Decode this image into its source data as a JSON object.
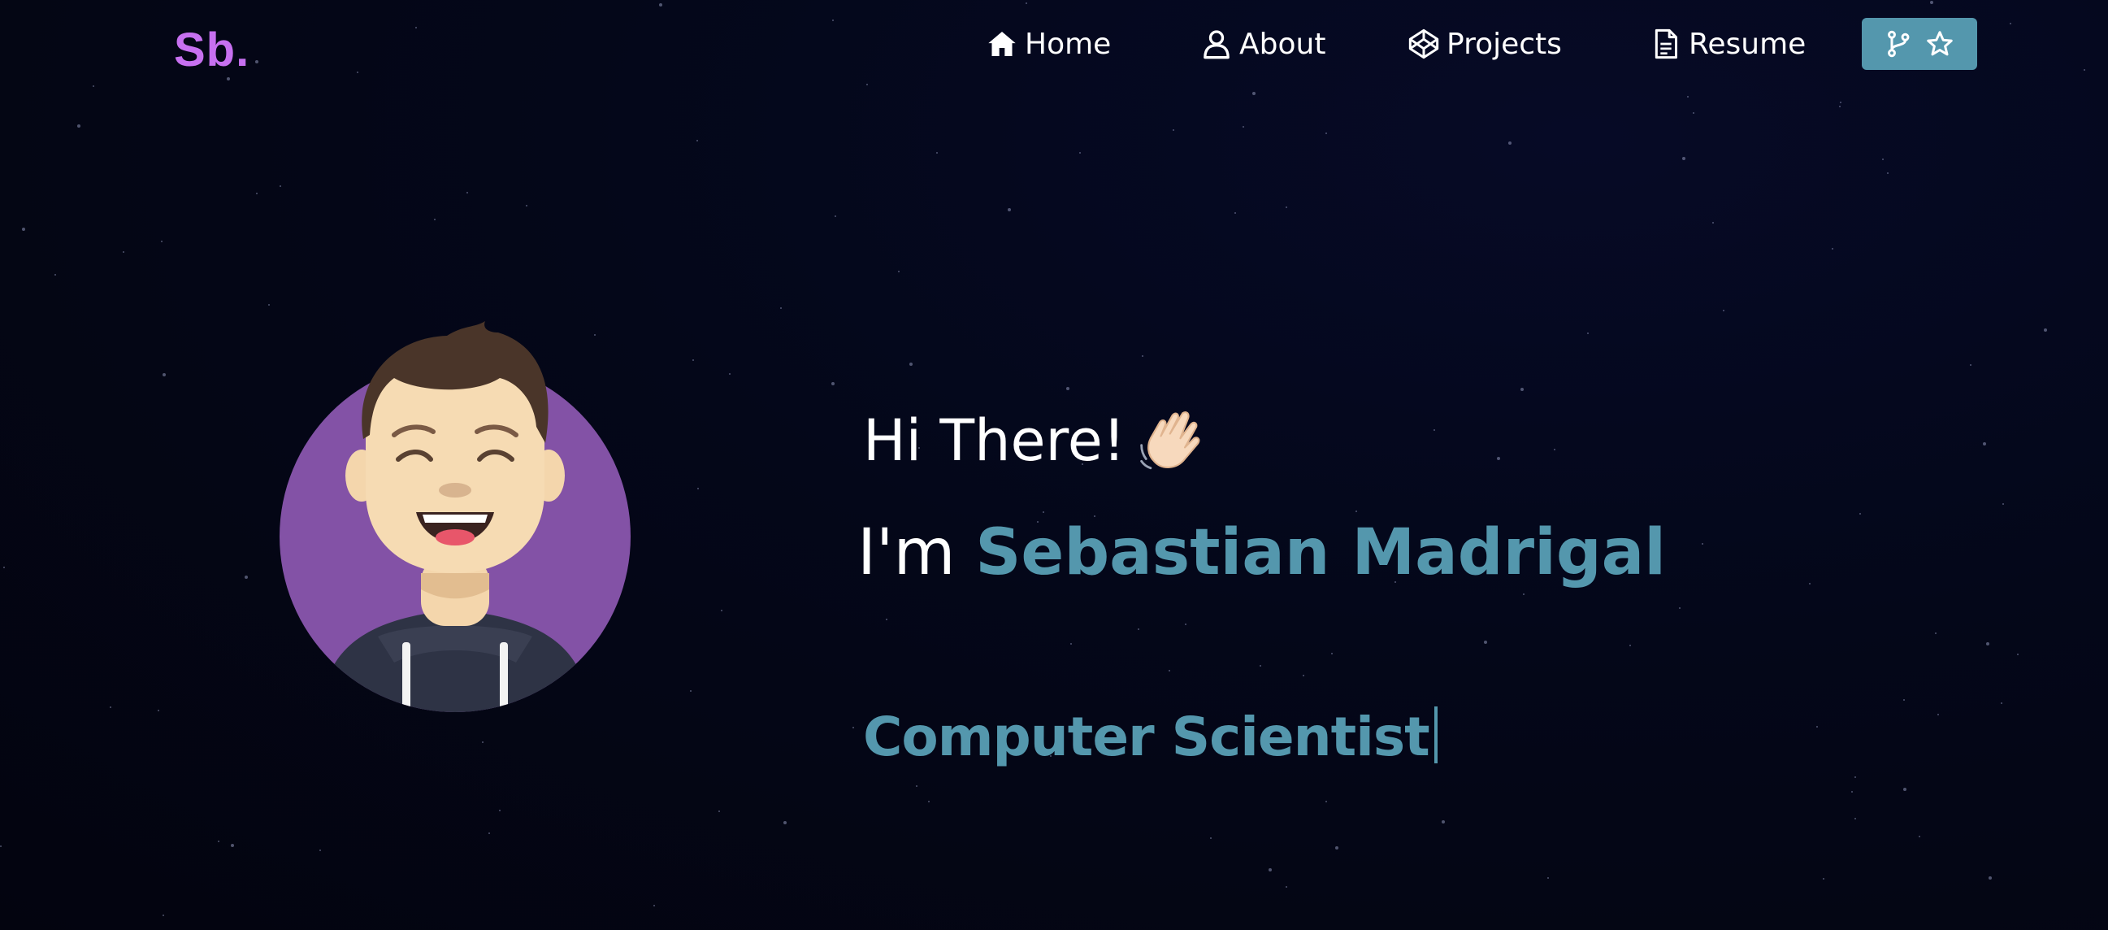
{
  "brand": {
    "logo_text": "Sb.",
    "logo_color": "#c770f0"
  },
  "nav": {
    "items": [
      {
        "label": "Home",
        "icon": "home-icon"
      },
      {
        "label": "About",
        "icon": "user-icon"
      },
      {
        "label": "Projects",
        "icon": "codepen-icon"
      },
      {
        "label": "Resume",
        "icon": "document-icon"
      }
    ],
    "github_button": {
      "icons": [
        "git-fork-icon",
        "star-icon"
      ],
      "color": "#5497ad"
    }
  },
  "hero": {
    "greeting": "Hi There!",
    "greeting_emoji": "waving-hand-icon",
    "intro_prefix": "I'm",
    "name": "Sebastian Madrigal",
    "typed_role": "Computer Scientist",
    "accent_color": "#5497ad",
    "avatar_bg_color": "#8352a6"
  }
}
